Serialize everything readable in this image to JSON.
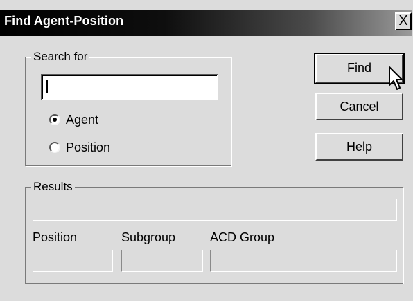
{
  "window": {
    "title": "Find Agent-Position",
    "close_glyph": "X"
  },
  "search": {
    "legend": "Search for",
    "input_value": "",
    "options": [
      {
        "label": "Agent",
        "selected": true
      },
      {
        "label": "Position",
        "selected": false
      }
    ]
  },
  "buttons": {
    "find": "Find",
    "cancel": "Cancel",
    "help": "Help"
  },
  "results": {
    "legend": "Results",
    "columns": {
      "position": "Position",
      "subgroup": "Subgroup",
      "acd_group": "ACD Group"
    }
  },
  "icons": {
    "pointer": "mouse-pointer-icon"
  }
}
